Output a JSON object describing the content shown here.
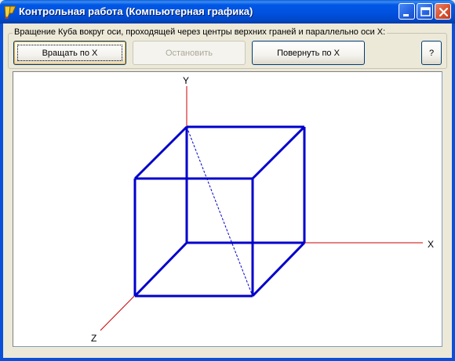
{
  "window": {
    "title": "Контрольная работа (Компьютерная графика)",
    "icon": "delphi-app-icon"
  },
  "group": {
    "caption": "Вращение Куба вокруг оси, проходящей через центры верхних граней и параллельно оси X:"
  },
  "toolbar": {
    "rotate_label": "Вращать по X",
    "stop_label": "Остановить",
    "turn_label": "Повернуть по X",
    "help_label": "?"
  },
  "axes": {
    "x_label": "X",
    "y_label": "Y",
    "z_label": "Z"
  },
  "colors": {
    "cube_edges": "#0000cc",
    "axes": "#cc0000",
    "diagonal": "#0000cc"
  }
}
